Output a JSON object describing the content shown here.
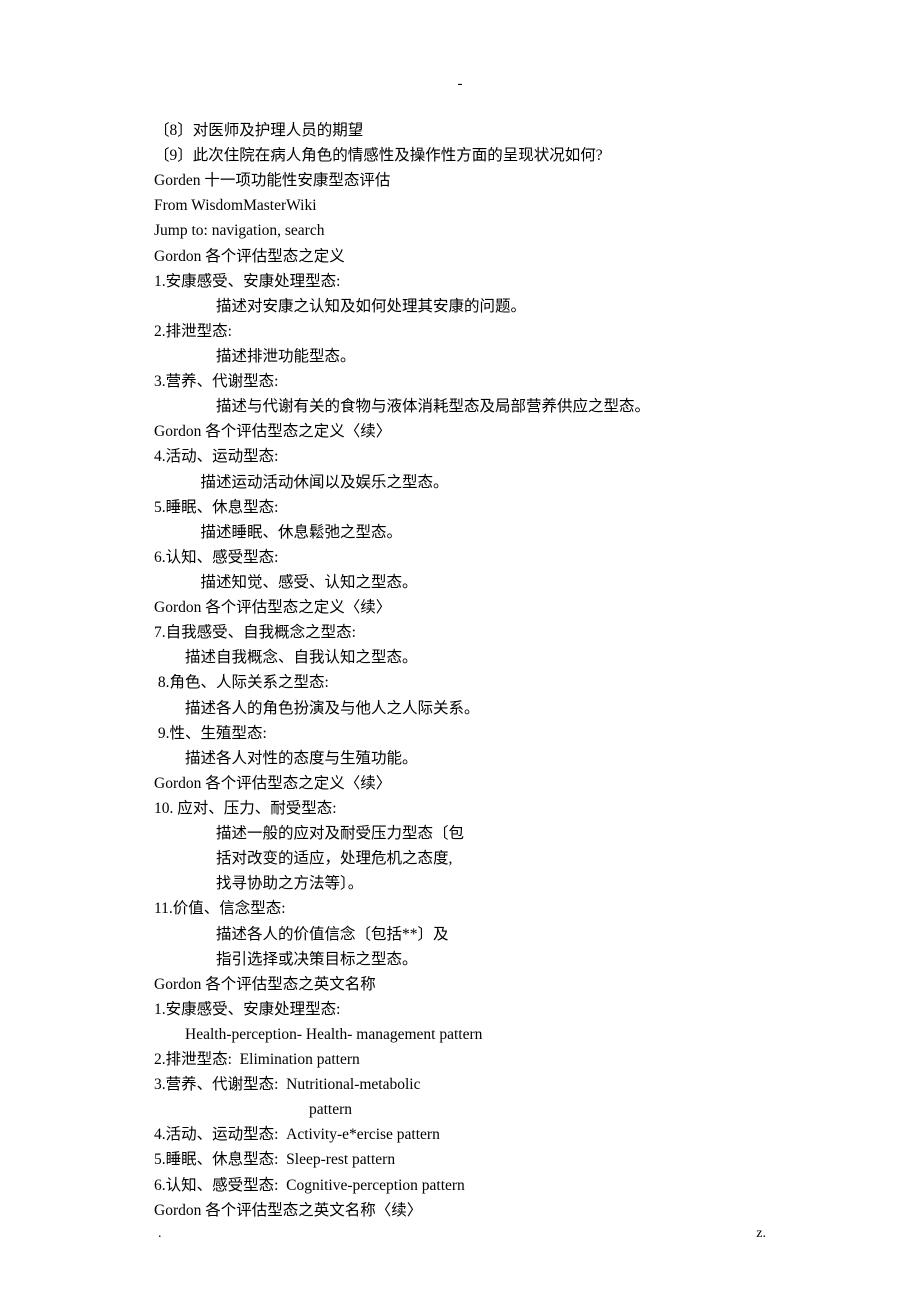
{
  "topmark": "-",
  "lines": [
    {
      "text": "〔8〕对医师及护理人员的期望",
      "indent": 0,
      "class": ""
    },
    {
      "text": "〔9〕此次住院在病人角色的情感性及操作性方面的呈现状况如何?",
      "indent": 0,
      "class": ""
    },
    {
      "text": "Gorden 十一项功能性安康型态评估",
      "indent": 0,
      "class": "english-mixed"
    },
    {
      "text": "From WisdomMasterWiki",
      "indent": 0,
      "class": "english"
    },
    {
      "text": "Jump to: navigation, search",
      "indent": 0,
      "class": "english"
    },
    {
      "text": "Gordon 各个评估型态之定义",
      "indent": 0,
      "class": "english-mixed"
    },
    {
      "text": "1.安康感受、安康处理型态:",
      "indent": 0,
      "class": ""
    },
    {
      "text": "描述对安康之认知及如何处理其安康的问题。",
      "indent": 4,
      "class": ""
    },
    {
      "text": "2.排泄型态:",
      "indent": 0,
      "class": ""
    },
    {
      "text": "描述排泄功能型态。",
      "indent": 4,
      "class": ""
    },
    {
      "text": "3.营养、代谢型态:",
      "indent": 0,
      "class": ""
    },
    {
      "text": "描述与代谢有关的食物与液体消耗型态及局部营养供应之型态。",
      "indent": 4,
      "class": ""
    },
    {
      "text": "Gordon 各个评估型态之定义〈续〉",
      "indent": 0,
      "class": "english-mixed"
    },
    {
      "text": "4.活动、运动型态:",
      "indent": 0,
      "class": ""
    },
    {
      "text": "描述运动活动休闻以及娱乐之型态。",
      "indent": 3,
      "class": ""
    },
    {
      "text": "5.睡眠、休息型态:",
      "indent": 0,
      "class": ""
    },
    {
      "text": "描述睡眠、休息鬆弛之型态。",
      "indent": 3,
      "class": ""
    },
    {
      "text": "6.认知、感受型态:",
      "indent": 0,
      "class": ""
    },
    {
      "text": "描述知觉、感受、认知之型态。",
      "indent": 3,
      "class": ""
    },
    {
      "text": "Gordon 各个评估型态之定义〈续〉",
      "indent": 0,
      "class": "english-mixed"
    },
    {
      "text": "7.自我感受、自我概念之型态:",
      "indent": 0,
      "class": ""
    },
    {
      "text": "描述自我概念、自我认知之型态。",
      "indent": 2,
      "class": ""
    },
    {
      "text": " 8.角色、人际关系之型态:",
      "indent": 0,
      "class": ""
    },
    {
      "text": "描述各人的角色扮演及与他人之人际关系。",
      "indent": 2,
      "class": ""
    },
    {
      "text": " 9.性、生殖型态:",
      "indent": 0,
      "class": ""
    },
    {
      "text": "描述各人对性的态度与生殖功能。",
      "indent": 2,
      "class": ""
    },
    {
      "text": "Gordon 各个评估型态之定义〈续〉",
      "indent": 0,
      "class": "english-mixed"
    },
    {
      "text": "10. 应对、压力、耐受型态:",
      "indent": 0,
      "class": ""
    },
    {
      "text": "描述一般的应对及耐受压力型态〔包",
      "indent": 4,
      "class": ""
    },
    {
      "text": "括对改变的适应，处理危机之态度,",
      "indent": 4,
      "class": ""
    },
    {
      "text": "找寻协助之方法等〕。",
      "indent": 4,
      "class": ""
    },
    {
      "text": "11.价值、信念型态:",
      "indent": 0,
      "class": ""
    },
    {
      "text": "描述各人的价值信念〔包括**〕及",
      "indent": 4,
      "class": ""
    },
    {
      "text": "指引选择或决策目标之型态。",
      "indent": 4,
      "class": ""
    },
    {
      "text": "Gordon 各个评估型态之英文名称",
      "indent": 0,
      "class": "english-mixed"
    },
    {
      "text": "1.安康感受、安康处理型态:",
      "indent": 0,
      "class": ""
    },
    {
      "text": "Health-perception- Health- management pattern",
      "indent": 2,
      "class": "english"
    },
    {
      "text": "2.排泄型态:  Elimination pattern",
      "indent": 0,
      "class": "english-mixed"
    },
    {
      "text": "3.营养、代谢型态:  Nutritional-metabolic",
      "indent": 0,
      "class": "english-mixed"
    },
    {
      "text": "pattern",
      "indent": 10,
      "class": "english"
    },
    {
      "text": "4.活动、运动型态:  Activity-e*ercise pattern",
      "indent": 0,
      "class": "english-mixed"
    },
    {
      "text": "5.睡眠、休息型态:  Sleep-rest pattern",
      "indent": 0,
      "class": "english-mixed"
    },
    {
      "text": "6.认知、感受型态:  Cognitive-perception pattern",
      "indent": 0,
      "class": "english-mixed"
    },
    {
      "text": "Gordon 各个评估型态之英文名称〈续〉",
      "indent": 0,
      "class": "english-mixed"
    }
  ],
  "footer": {
    "left": ".",
    "right": "z."
  }
}
